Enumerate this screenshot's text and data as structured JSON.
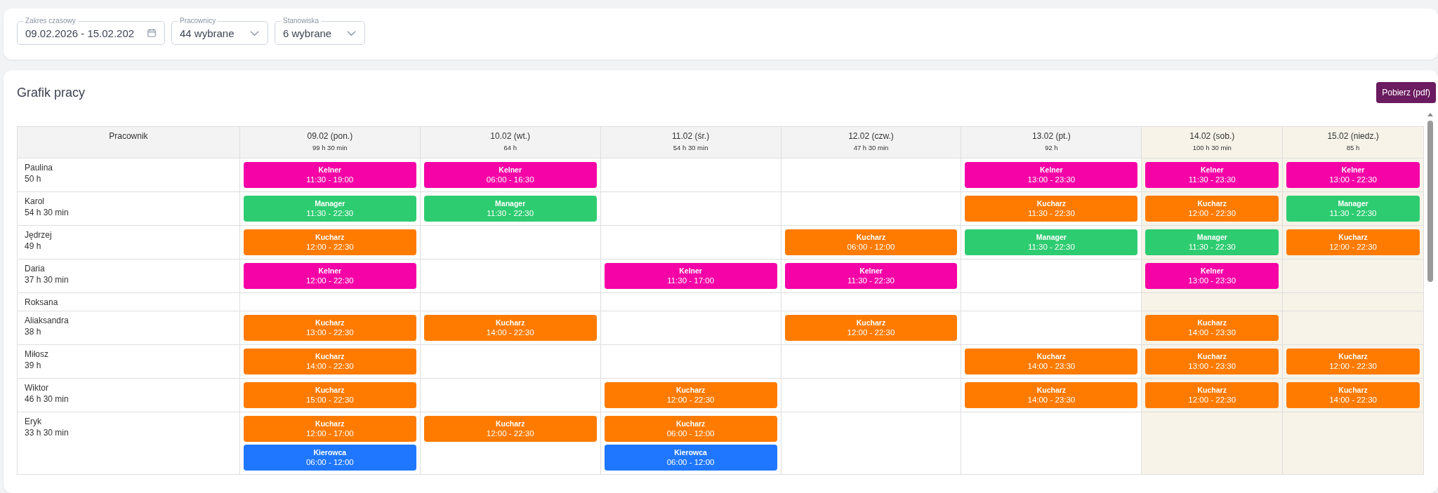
{
  "filters": [
    {
      "label": "Zakres czasowy",
      "value": "09.02.2026 - 15.02.202",
      "kind": "date"
    },
    {
      "label": "Pracownicy",
      "value": "44 wybrane",
      "kind": "select"
    },
    {
      "label": "Stanowiska",
      "value": "6 wybrane",
      "kind": "select"
    }
  ],
  "schedule": {
    "title": "Grafik pracy",
    "download_button": "Pobierz (pdf)",
    "table": {
      "columns": [
        {
          "label": "Pracownik"
        },
        {
          "label": "09.02 (pon.)",
          "total": "99 h 30 min",
          "weekend": false
        },
        {
          "label": "10.02 (wt.)",
          "total": "64 h",
          "weekend": false
        },
        {
          "label": "11.02 (śr.)",
          "total": "54 h 30 min",
          "weekend": false
        },
        {
          "label": "12.02 (czw.)",
          "total": "47 h 30 min",
          "weekend": false
        },
        {
          "label": "13.02 (pt.)",
          "total": "92 h",
          "weekend": false
        },
        {
          "label": "14.02 (sob.)",
          "total": "100 h 30 min",
          "weekend": true
        },
        {
          "label": "15.02 (niedz.)",
          "total": "85 h",
          "weekend": true
        }
      ],
      "rows": [
        {
          "name": "Paulina",
          "hours": "50 h",
          "days": {
            "day_1": [
              {
                "role": "Kelner",
                "time": "11:30 - 19:00",
                "color": "#f503a6"
              }
            ],
            "day_2": [
              {
                "role": "Kelner",
                "time": "06:00 - 16:30",
                "color": "#f503a6"
              }
            ],
            "day_5": [
              {
                "role": "Kelner",
                "time": "13:00 - 23:30",
                "color": "#f503a6"
              }
            ],
            "day_6": [
              {
                "role": "Kelner",
                "time": "11:30 - 23:30",
                "color": "#f503a6"
              }
            ],
            "day_7": [
              {
                "role": "Kelner",
                "time": "13:00 - 22:30",
                "color": "#f503a6"
              }
            ]
          }
        },
        {
          "name": "Karol",
          "hours": "54 h 30 min",
          "days": {
            "day_1": [
              {
                "role": "Manager",
                "time": "11:30 - 22:30",
                "color": "#2ecc71"
              }
            ],
            "day_2": [
              {
                "role": "Manager",
                "time": "11:30 - 22:30",
                "color": "#2ecc71"
              }
            ],
            "day_5": [
              {
                "role": "Kucharz",
                "time": "11:30 - 22:30",
                "color": "#ff7b00"
              }
            ],
            "day_6": [
              {
                "role": "Kucharz",
                "time": "12:00 - 22:30",
                "color": "#ff7b00"
              }
            ],
            "day_7": [
              {
                "role": "Manager",
                "time": "11:30 - 22:30",
                "color": "#2ecc71"
              }
            ]
          }
        },
        {
          "name": "Jędrzej",
          "hours": "49 h",
          "days": {
            "day_1": [
              {
                "role": "Kucharz",
                "time": "12:00 - 22:30",
                "color": "#ff7b00"
              }
            ],
            "day_4": [
              {
                "role": "Kucharz",
                "time": "06:00 - 12:00",
                "color": "#ff7b00"
              }
            ],
            "day_5": [
              {
                "role": "Manager",
                "time": "11:30 - 22:30",
                "color": "#2ecc71"
              }
            ],
            "day_6": [
              {
                "role": "Manager",
                "time": "11:30 - 22:30",
                "color": "#2ecc71"
              }
            ],
            "day_7": [
              {
                "role": "Kucharz",
                "time": "12:00 - 22:30",
                "color": "#ff7b00"
              }
            ]
          }
        },
        {
          "name": "Daria",
          "hours": "37 h 30 min",
          "days": {
            "day_1": [
              {
                "role": "Kelner",
                "time": "12:00 - 22:30",
                "color": "#f503a6"
              }
            ],
            "day_3": [
              {
                "role": "Kelner",
                "time": "11:30 - 17:00",
                "color": "#f503a6"
              }
            ],
            "day_4": [
              {
                "role": "Kelner",
                "time": "11:30 - 22:30",
                "color": "#f503a6"
              }
            ],
            "day_6": [
              {
                "role": "Kelner",
                "time": "13:00 - 23:30",
                "color": "#f503a6"
              }
            ]
          }
        },
        {
          "name": "Roksana"
        },
        {
          "name": "Aliaksandra",
          "hours": "38 h",
          "days": {
            "day_1": [
              {
                "role": "Kucharz",
                "time": "13:00 - 22:30",
                "color": "#ff7b00"
              }
            ],
            "day_2": [
              {
                "role": "Kucharz",
                "time": "14:00 - 22:30",
                "color": "#ff7b00"
              }
            ],
            "day_4": [
              {
                "role": "Kucharz",
                "time": "12:00 - 22:30",
                "color": "#ff7b00"
              }
            ],
            "day_6": [
              {
                "role": "Kucharz",
                "time": "14:00 - 23:30",
                "color": "#ff7b00"
              }
            ]
          }
        },
        {
          "name": "Miłosz",
          "hours": "39 h",
          "days": {
            "day_1": [
              {
                "role": "Kucharz",
                "time": "14:00 - 22:30",
                "color": "#ff7b00"
              }
            ],
            "day_5": [
              {
                "role": "Kucharz",
                "time": "14:00 - 23:30",
                "color": "#ff7b00"
              }
            ],
            "day_6": [
              {
                "role": "Kucharz",
                "time": "13:00 - 23:30",
                "color": "#ff7b00"
              }
            ],
            "day_7": [
              {
                "role": "Kucharz",
                "time": "12:00 - 22:30",
                "color": "#ff7b00"
              }
            ]
          }
        },
        {
          "name": "Wiktor",
          "hours": "46 h 30 min",
          "days": {
            "day_1": [
              {
                "role": "Kucharz",
                "time": "15:00 - 22:30",
                "color": "#ff7b00"
              }
            ],
            "day_3": [
              {
                "role": "Kucharz",
                "time": "12:00 - 22:30",
                "color": "#ff7b00"
              }
            ],
            "day_5": [
              {
                "role": "Kucharz",
                "time": "14:00 - 23:30",
                "color": "#ff7b00"
              }
            ],
            "day_6": [
              {
                "role": "Kucharz",
                "time": "12:00 - 22:30",
                "color": "#ff7b00"
              }
            ],
            "day_7": [
              {
                "role": "Kucharz",
                "time": "14:00 - 22:30",
                "color": "#ff7b00"
              }
            ]
          }
        },
        {
          "name": "Eryk",
          "hours": "33 h 30 min",
          "days": {
            "day_1": [
              {
                "role": "Kucharz",
                "time": "12:00 - 17:00",
                "color": "#ff7b00"
              },
              {
                "role": "Kierowca",
                "time": "06:00 - 12:00",
                "color": "#1f77ff"
              }
            ],
            "day_2": [
              {
                "role": "Kucharz",
                "time": "12:00 - 22:30",
                "color": "#ff7b00"
              }
            ],
            "day_3": [
              {
                "role": "Kucharz",
                "time": "06:00 - 12:00",
                "color": "#ff7b00"
              },
              {
                "role": "Kierowca",
                "time": "06:00 - 12:00",
                "color": "#1f77ff"
              }
            ]
          }
        }
      ]
    }
  }
}
